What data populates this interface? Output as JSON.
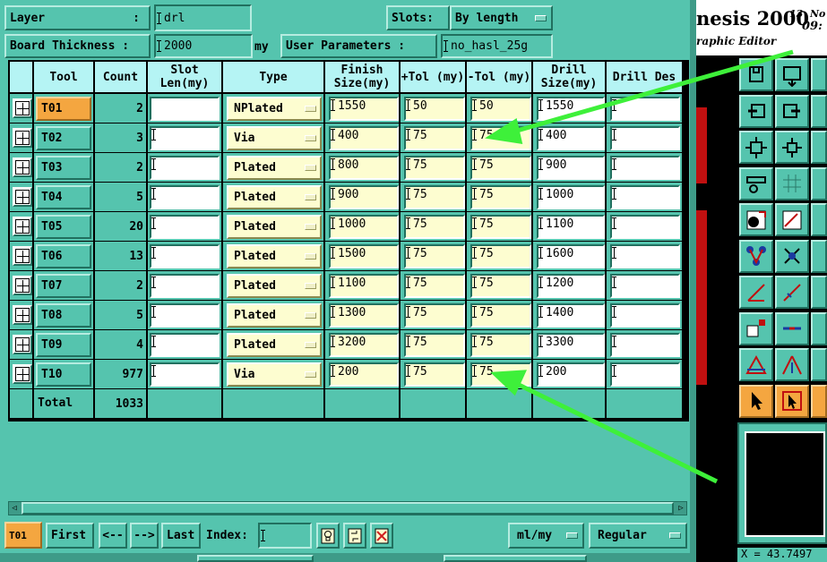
{
  "header": {
    "layer_label": "Layer",
    "layer_value": "drl",
    "slots_label": "Slots:",
    "slots_value": "By length",
    "board_thickness_label": "Board Thickness :",
    "board_thickness_value": "2000",
    "board_thickness_unit": "my",
    "user_params_label": "User Parameters :",
    "user_params_value": "no_hasl_25g"
  },
  "columns": [
    "Tool",
    "Count",
    "Slot Len(my)",
    "Type",
    "Finish Size(my)",
    "+Tol (my)",
    "-Tol (my)",
    "Drill Size(my)",
    "Drill Des"
  ],
  "rows": [
    {
      "tool": "T01",
      "count": "2",
      "slot_len": "",
      "type": "NPlated",
      "finish": "1550",
      "ptol": "50",
      "mtol": "50",
      "drill": "1550",
      "des": ""
    },
    {
      "tool": "T02",
      "count": "3",
      "slot_len": "",
      "type": "Via",
      "finish": "400",
      "ptol": "75",
      "mtol": "75",
      "drill": "400",
      "des": ""
    },
    {
      "tool": "T03",
      "count": "2",
      "slot_len": "",
      "type": "Plated",
      "finish": "800",
      "ptol": "75",
      "mtol": "75",
      "drill": "900",
      "des": ""
    },
    {
      "tool": "T04",
      "count": "5",
      "slot_len": "",
      "type": "Plated",
      "finish": "900",
      "ptol": "75",
      "mtol": "75",
      "drill": "1000",
      "des": ""
    },
    {
      "tool": "T05",
      "count": "20",
      "slot_len": "",
      "type": "Plated",
      "finish": "1000",
      "ptol": "75",
      "mtol": "75",
      "drill": "1100",
      "des": ""
    },
    {
      "tool": "T06",
      "count": "13",
      "slot_len": "",
      "type": "Plated",
      "finish": "1500",
      "ptol": "75",
      "mtol": "75",
      "drill": "1600",
      "des": ""
    },
    {
      "tool": "T07",
      "count": "2",
      "slot_len": "",
      "type": "Plated",
      "finish": "1100",
      "ptol": "75",
      "mtol": "75",
      "drill": "1200",
      "des": ""
    },
    {
      "tool": "T08",
      "count": "5",
      "slot_len": "",
      "type": "Plated",
      "finish": "1300",
      "ptol": "75",
      "mtol": "75",
      "drill": "1400",
      "des": ""
    },
    {
      "tool": "T09",
      "count": "4",
      "slot_len": "",
      "type": "Plated",
      "finish": "3200",
      "ptol": "75",
      "mtol": "75",
      "drill": "3300",
      "des": ""
    },
    {
      "tool": "T10",
      "count": "977",
      "slot_len": "",
      "type": "Via",
      "finish": "200",
      "ptol": "75",
      "mtol": "75",
      "drill": "200",
      "des": ""
    }
  ],
  "total": {
    "label": "Total",
    "count": "1033"
  },
  "footer": {
    "current_tool": "T01",
    "first": "First",
    "prev": "<--",
    "next": "-->",
    "last": "Last",
    "index_label": "Index:",
    "index_value": "",
    "units_value": "ml/my",
    "mode_value": "Regular"
  },
  "right_panel": {
    "title": "nesis 2000",
    "time_top": "13  No",
    "time_bottom": "09:",
    "subtitle": "raphic Editor",
    "coord_readout": "X = 43.7497"
  },
  "colors": {
    "panel": "#55c4ae",
    "header_cell": "#b5f4f4",
    "selected": "#f4a640",
    "field_yellow": "#fdfdd0",
    "arrow": "#3ef03a"
  },
  "icons": {
    "expand": "expand-plus-icon",
    "lightbulb": "lightbulb-icon",
    "refresh": "refresh-icon",
    "close": "close-x-icon"
  }
}
